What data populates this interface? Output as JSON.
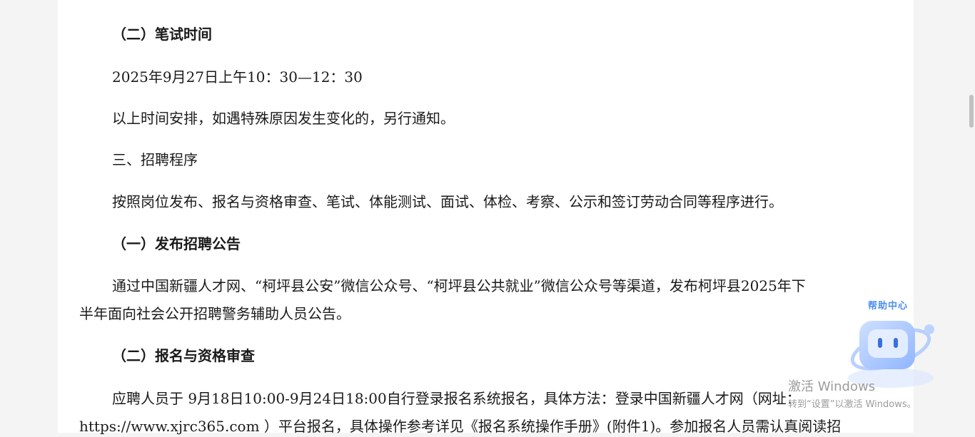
{
  "document": {
    "p1": "（二）笔试时间",
    "p2": "2025年9月27日上午10：30—12：30",
    "p3": "以上时间安排，如遇特殊原因发生变化的，另行通知。",
    "p4": "三、招聘程序",
    "p5": "按照岗位发布、报名与资格审查、笔试、体能测试、面试、体检、考察、公示和签订劳动合同等程序进行。",
    "p6": "（一）发布招聘公告",
    "p7a": "通过中国新疆人才网、“柯坪县公安”微信公众号、“柯坪县公共就业”微信公众号等渠道，发布柯坪县2025年下",
    "p7b": "半年面向社会公开招聘警务辅助人员公告。",
    "p8": "（二）报名与资格审查",
    "p9a": "应聘人员于 9月18日10:00-9月24日18:00自行登录报名系统报名，具体方法：登录中国新疆人才网（网址：",
    "p9b": "https://www.xjrc365.com ）平台报名，具体操作参考详见《报名系统操作手册》(附件1)。参加报名人员需认真阅读招"
  },
  "help_widget": {
    "title": "帮助中心"
  },
  "watermark": {
    "line1": "激活 Windows",
    "line2": "转到“设置”以激活 Windows。"
  },
  "colors": {
    "page_bg": "#ffffff",
    "outer_bg": "#f4f4f4",
    "help_accent": "#4a8df0"
  }
}
